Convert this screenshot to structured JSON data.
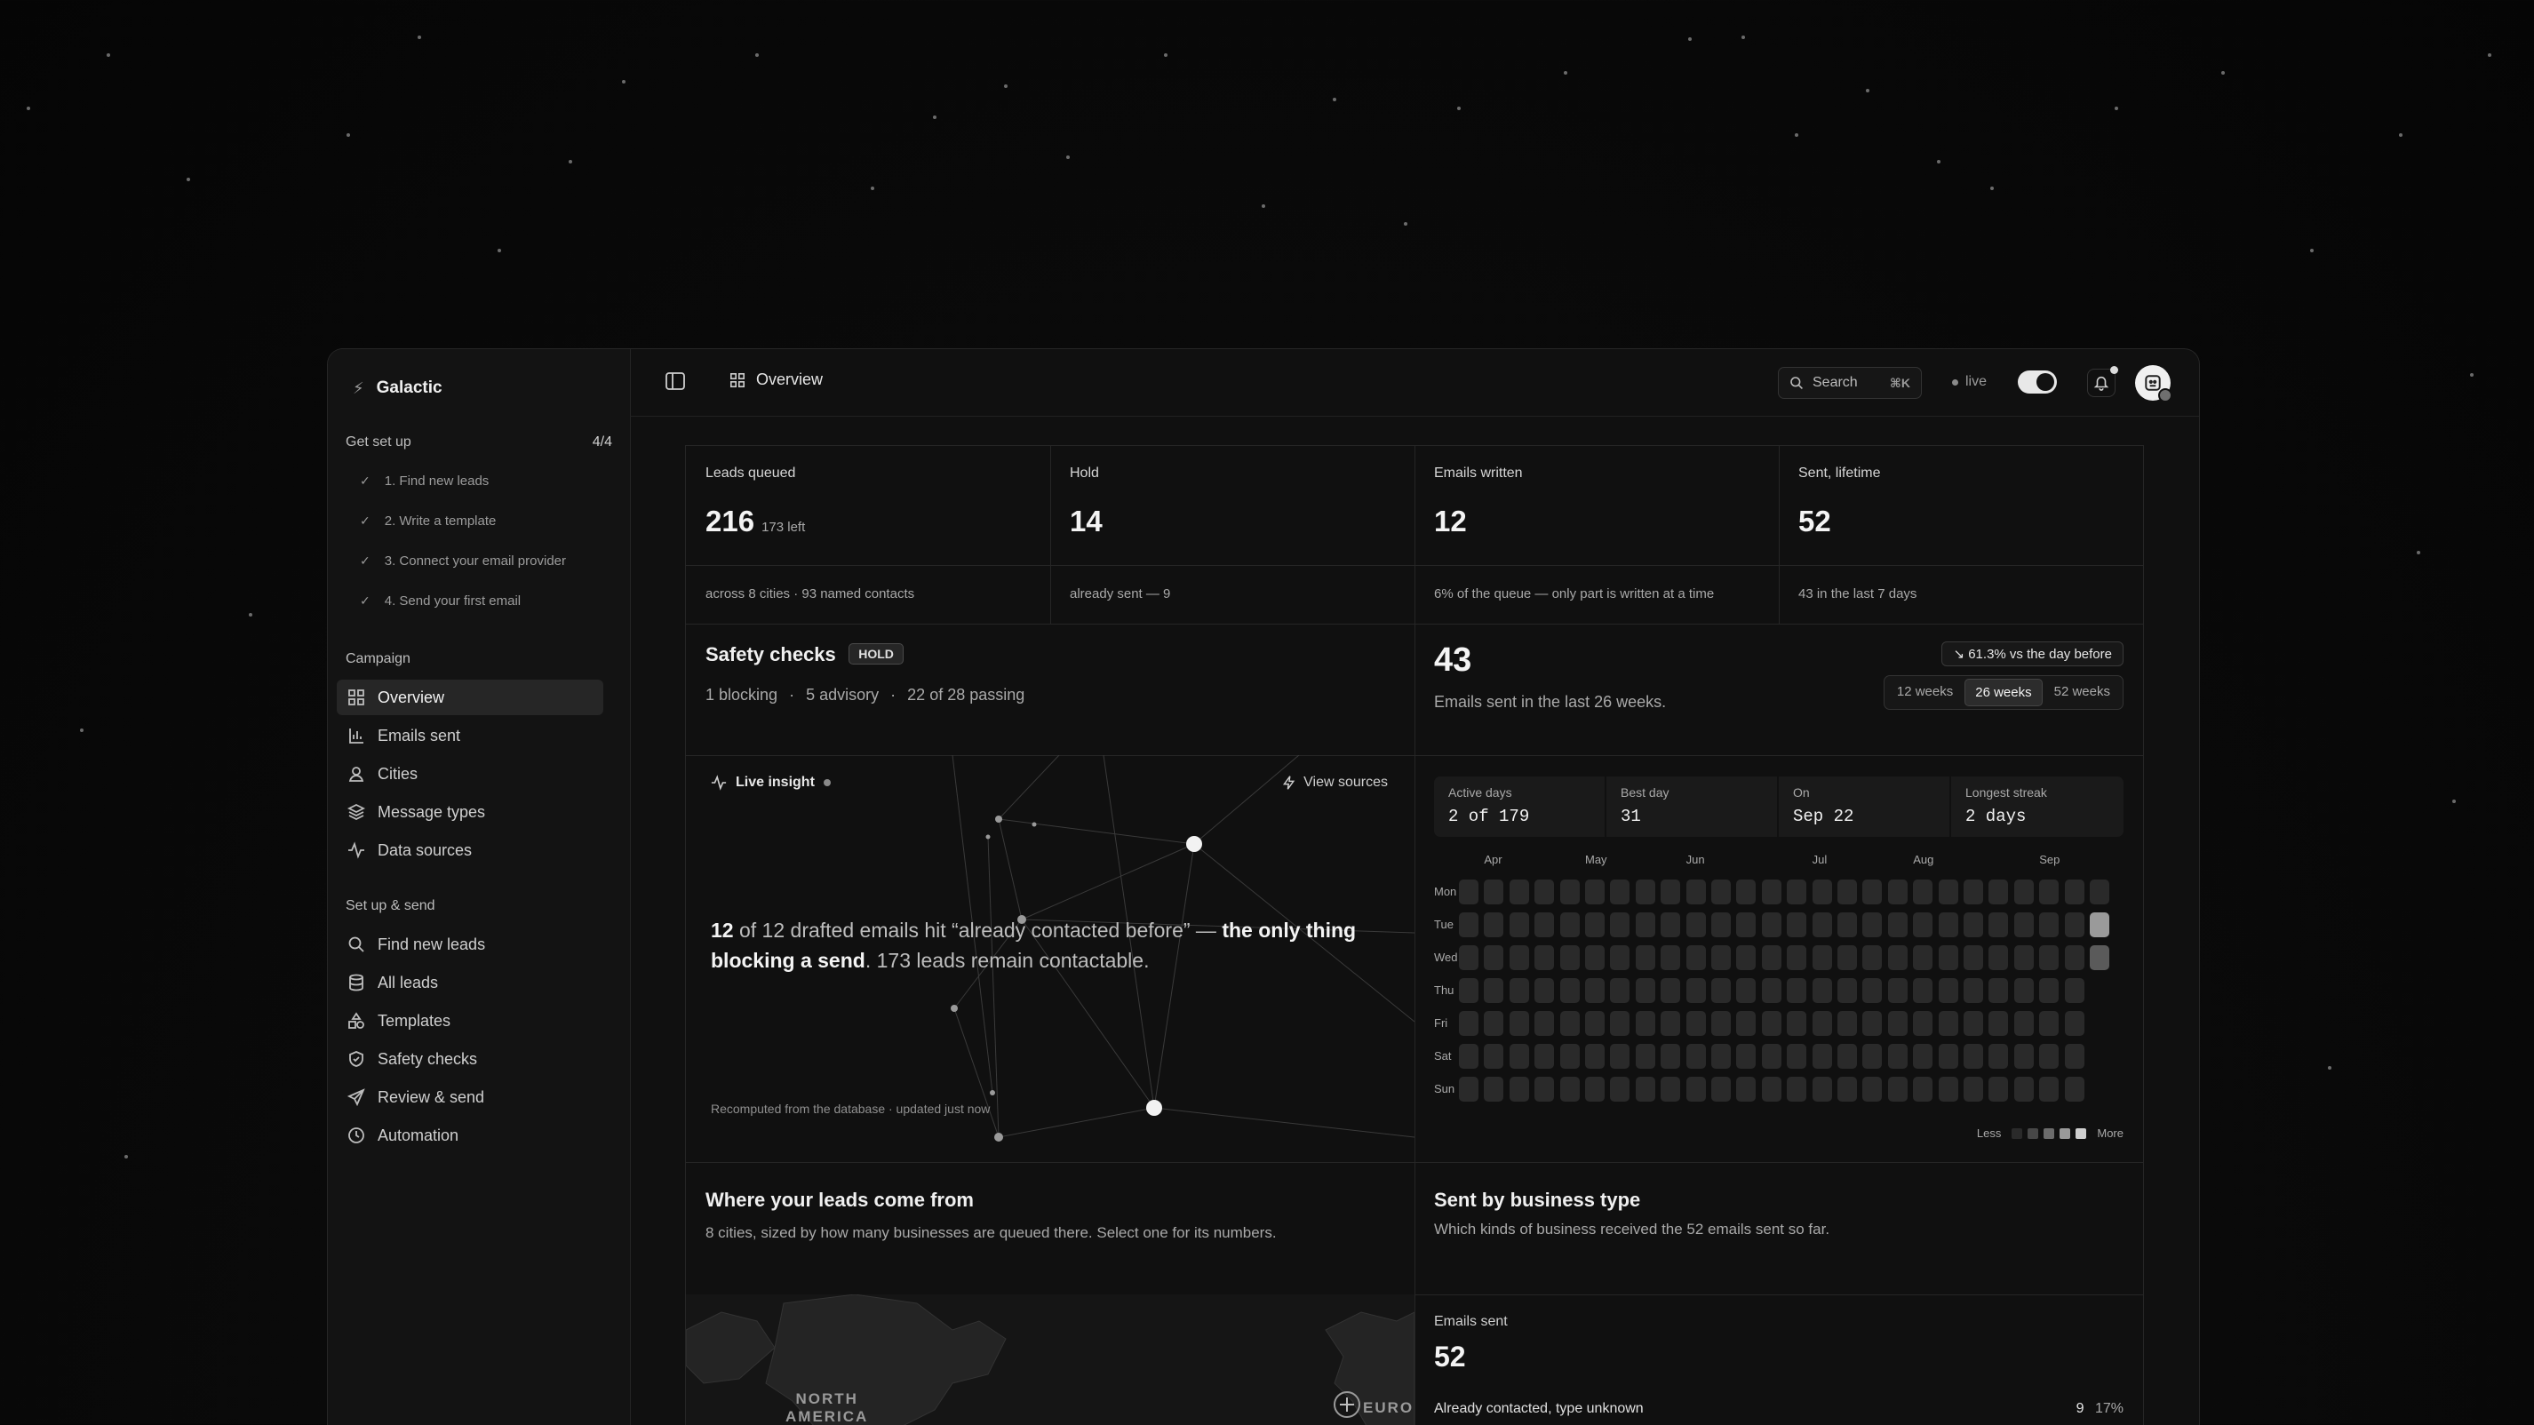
{
  "brand": {
    "name": "Galactic"
  },
  "setup": {
    "title": "Get set up",
    "count": "4/4",
    "items": [
      "1. Find new leads",
      "2. Write a template",
      "3. Connect your email provider",
      "4. Send your first email"
    ]
  },
  "nav": {
    "campaign_title": "Campaign",
    "campaign": [
      {
        "label": "Overview",
        "icon": "grid-icon",
        "active": true
      },
      {
        "label": "Emails sent",
        "icon": "bar-chart-icon"
      },
      {
        "label": "Cities",
        "icon": "user-icon"
      },
      {
        "label": "Message types",
        "icon": "layers-icon"
      },
      {
        "label": "Data sources",
        "icon": "activity-icon"
      }
    ],
    "send_title": "Set up & send",
    "send": [
      {
        "label": "Find new leads",
        "icon": "search-icon"
      },
      {
        "label": "All leads",
        "icon": "database-icon"
      },
      {
        "label": "Templates",
        "icon": "shapes-icon"
      },
      {
        "label": "Safety checks",
        "icon": "shield-icon"
      },
      {
        "label": "Review & send",
        "icon": "send-icon"
      },
      {
        "label": "Automation",
        "icon": "clock-icon"
      }
    ]
  },
  "topbar": {
    "title": "Overview",
    "search_label": "Search",
    "search_kbd": "⌘K",
    "live_label": "live"
  },
  "kpis": [
    {
      "label": "Leads queued",
      "value": "216",
      "sub": "173 left",
      "foot": "across 8 cities · 93 named contacts"
    },
    {
      "label": "Hold",
      "value": "14",
      "sub": "",
      "foot": "already sent — 9"
    },
    {
      "label": "Emails written",
      "value": "12",
      "sub": "",
      "foot": "6% of the queue — only part is written at a time"
    },
    {
      "label": "Sent, lifetime",
      "value": "52",
      "sub": "",
      "foot": "43 in the last 7 days"
    }
  ],
  "safety": {
    "title": "Safety checks",
    "badge": "HOLD",
    "blocking": "1 blocking",
    "advisory": "5 advisory",
    "passing": "22 of 28 passing"
  },
  "sent": {
    "value": "43",
    "caption": "Emails sent in the last 26 weeks.",
    "change": "61.3% vs the day before",
    "ranges": [
      "12 weeks",
      "26 weeks",
      "52 weeks"
    ],
    "active_range": "26 weeks",
    "stats": [
      {
        "label": "Active days",
        "value": "2 of 179"
      },
      {
        "label": "Best day",
        "value": "31"
      },
      {
        "label": "On",
        "value": "Sep 22"
      },
      {
        "label": "Longest streak",
        "value": "2 days"
      }
    ],
    "months": [
      "Apr",
      "May",
      "Jun",
      "Jul",
      "Aug",
      "Sep"
    ],
    "days": [
      "Mon",
      "Tue",
      "Wed",
      "Thu",
      "Fri",
      "Sat",
      "Sun"
    ],
    "legend_less": "Less",
    "legend_more": "More"
  },
  "insight": {
    "title": "Live insight",
    "view_sources": "View sources",
    "num": "12",
    "text_a": " of 12 drafted emails hit “already contacted before” — ",
    "text_b": "the only thing blocking a send",
    "text_c": ". 173 leads remain contactable.",
    "footer": "Recomputed from the database · updated just now"
  },
  "leads_map": {
    "title": "Where your leads come from",
    "subtitle": "8 cities, sized by how many businesses are queued there. Select one for its numbers.",
    "label_na_1": "NORTH",
    "label_na_2": "AMERICA",
    "label_eu": "EURO"
  },
  "business": {
    "title": "Sent by business type",
    "subtitle": "Which kinds of business received the 52 emails sent so far.",
    "emails_label": "Emails sent",
    "emails_value": "52",
    "rows": [
      {
        "label": "Already contacted, type unknown",
        "count": "9",
        "pct": "17%",
        "fraction": 0.17
      }
    ]
  },
  "colors": {
    "accent": "#e8e8e8",
    "panel": "#101010",
    "border": "#262626"
  }
}
